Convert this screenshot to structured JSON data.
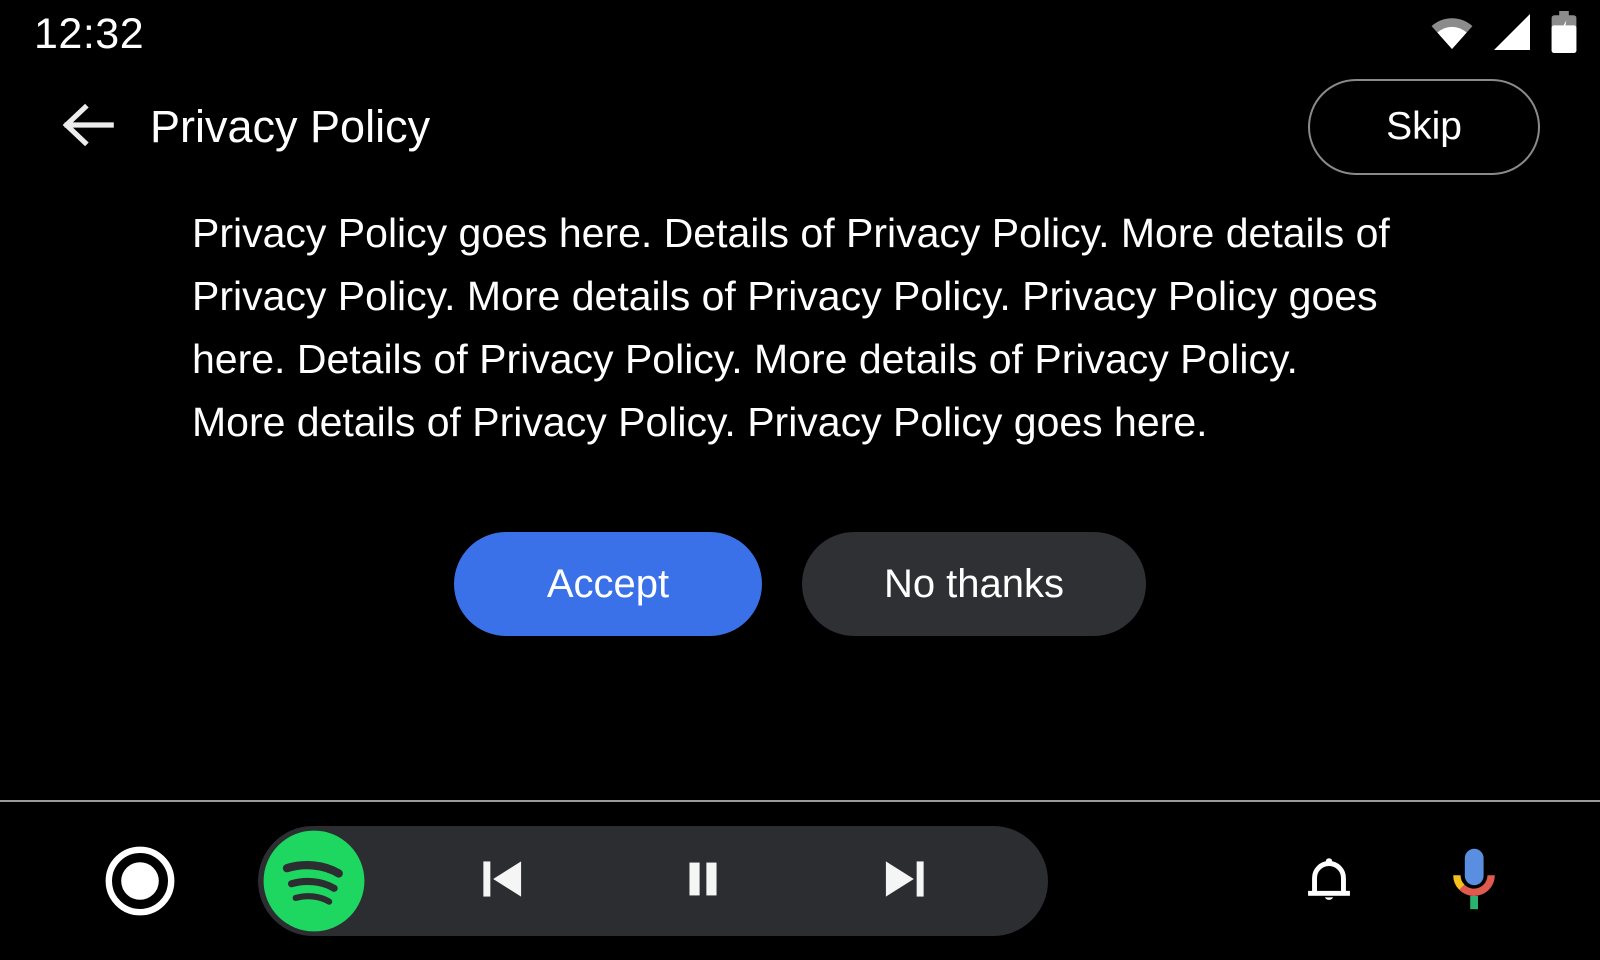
{
  "status_bar": {
    "clock": "12:32",
    "icons": [
      "wifi-icon",
      "cellular-signal-icon",
      "battery-charging-icon"
    ]
  },
  "header": {
    "back_icon": "arrow-back-icon",
    "title": "Privacy Policy",
    "skip_label": "Skip"
  },
  "main": {
    "policy_text": "Privacy Policy goes here. Details of Privacy Policy. More details of Privacy Policy. More details of Privacy Policy. Privacy Policy goes here. Details of Privacy Policy. More details of Privacy Policy. More details of Privacy Policy. Privacy Policy goes here.",
    "accept_label": "Accept",
    "decline_label": "No thanks"
  },
  "nav_bar": {
    "home_icon": "home-circle-icon",
    "media_app_icon": "spotify-icon",
    "previous_icon": "skip-previous-icon",
    "play_pause_icon": "pause-icon",
    "next_icon": "skip-next-icon",
    "notifications_icon": "bell-icon",
    "assistant_icon": "google-assistant-mic-icon"
  },
  "colors": {
    "background": "#000000",
    "accent_blue": "#3b71e8",
    "surface_grey": "#2e3033",
    "media_pill": "#2b2d31",
    "spotify_green": "#1ed760",
    "divider": "#9a9a9a"
  }
}
